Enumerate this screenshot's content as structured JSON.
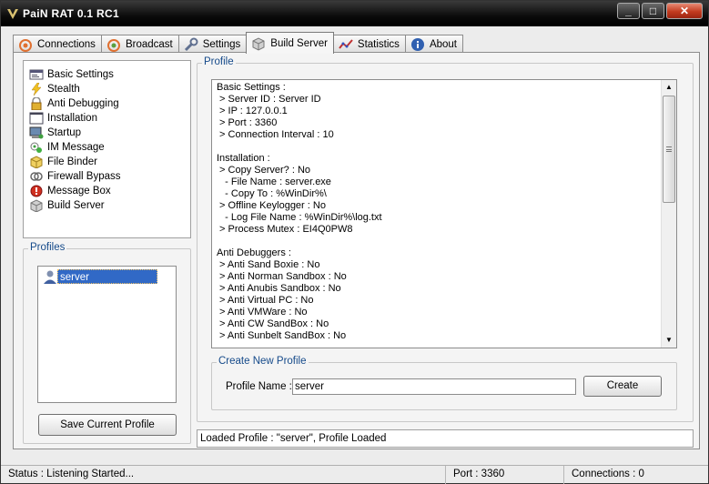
{
  "window": {
    "title": "PaiN RAT 0.1 RC1",
    "minimize": "_",
    "maximize": "□",
    "close": "✕"
  },
  "tabs": [
    {
      "label": "Connections",
      "icon": "connections-icon",
      "active": false
    },
    {
      "label": "Broadcast",
      "icon": "broadcast-icon",
      "active": false
    },
    {
      "label": "Settings",
      "icon": "wrench-icon",
      "active": false
    },
    {
      "label": "Build Server",
      "icon": "box-icon",
      "active": true
    },
    {
      "label": "Statistics",
      "icon": "chart-icon",
      "active": false
    },
    {
      "label": "About",
      "icon": "info-icon",
      "active": false
    }
  ],
  "settings_list": [
    {
      "label": "Basic Settings",
      "icon": "settings-window-icon"
    },
    {
      "label": "Stealth",
      "icon": "lightning-icon"
    },
    {
      "label": "Anti Debugging",
      "icon": "lock-icon"
    },
    {
      "label": "Installation",
      "icon": "blank-window-icon"
    },
    {
      "label": "Startup",
      "icon": "computer-icon"
    },
    {
      "label": "IM Message",
      "icon": "messenger-icon"
    },
    {
      "label": "File Binder",
      "icon": "cube-icon"
    },
    {
      "label": "Firewall Bypass",
      "icon": "network-icon"
    },
    {
      "label": "Message Box",
      "icon": "error-icon"
    },
    {
      "label": "Build Server",
      "icon": "box-icon"
    }
  ],
  "profiles": {
    "legend": "Profiles",
    "items": [
      "server"
    ],
    "save_button": "Save Current Profile"
  },
  "profile": {
    "legend": "Profile",
    "lines": [
      "Basic Settings :",
      " > Server ID : Server ID",
      " > IP : 127.0.0.1",
      " > Port : 3360",
      " > Connection Interval : 10",
      "",
      "Installation :",
      " > Copy Server? : No",
      "   - File Name : server.exe",
      "   - Copy To : %WinDir%\\",
      " > Offline Keylogger : No",
      "   - Log File Name : %WinDir%\\log.txt",
      " > Process Mutex : EI4Q0PW8",
      "",
      "Anti Debuggers :",
      " > Anti Sand Boxie : No",
      " > Anti Norman Sandbox : No",
      " > Anti Anubis Sandbox : No",
      " > Anti Virtual PC : No",
      " > Anti VMWare : No",
      " > Anti CW SandBox : No",
      " > Anti Sunbelt SandBox : No"
    ]
  },
  "create_profile": {
    "legend": "Create New Profile",
    "name_label": "Profile Name :",
    "name_value": "server",
    "create_button": "Create"
  },
  "log": "Loaded Profile : \"server\", Profile Loaded",
  "status": {
    "status": "Status : Listening Started...",
    "port": "Port : 3360",
    "connections": "Connections : 0"
  }
}
